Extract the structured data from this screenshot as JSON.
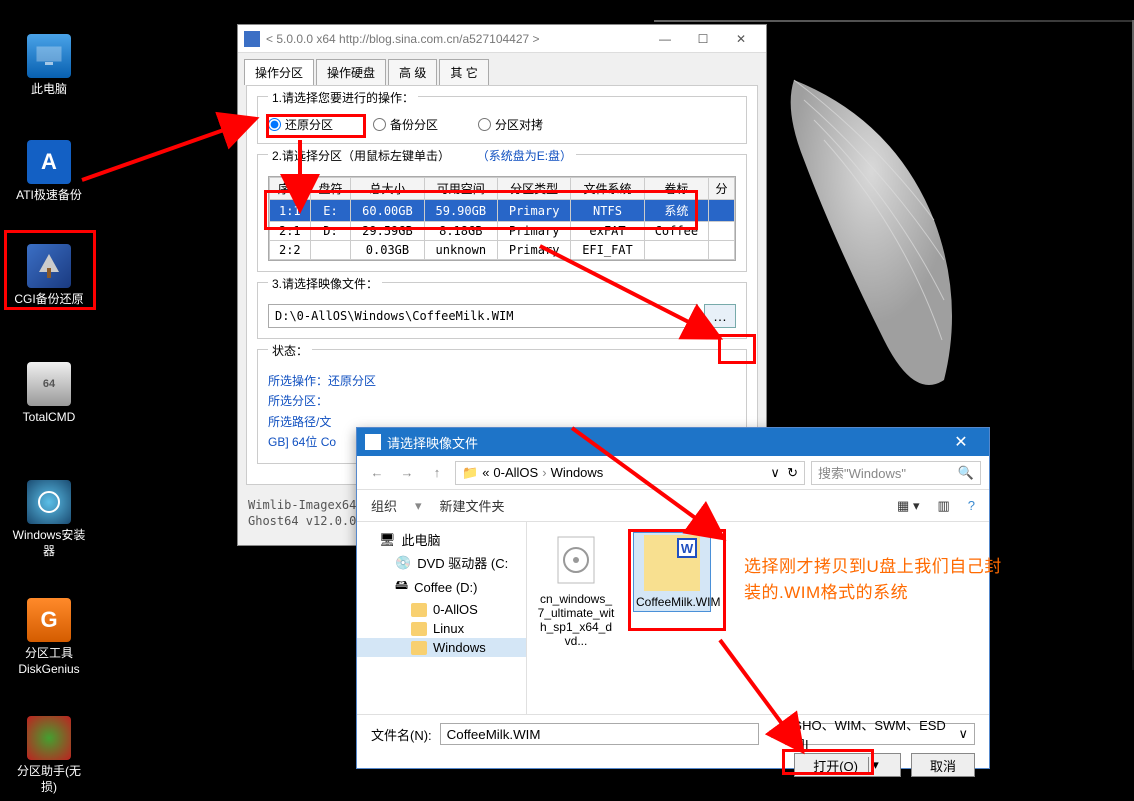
{
  "desktop_icons": {
    "pc": "此电脑",
    "ati": "ATI极速备份",
    "ati_letter": "A",
    "cgi": "CGI备份还原",
    "tc": "TotalCMD",
    "tc_badge": "64",
    "win": "Windows安装器",
    "dg": "分区工具DiskGenius",
    "dg_letter": "G",
    "pa": "分区助手(无损)"
  },
  "window": {
    "title": "< 5.0.0.0 x64 http://blog.sina.com.cn/a527104427 >",
    "tabs": [
      "操作分区",
      "操作硬盘",
      "高 级",
      "其 它"
    ],
    "section1": "1.请选择您要进行的操作：",
    "radios": [
      "还原分区",
      "备份分区",
      "分区对拷"
    ],
    "section2": "2.请选择分区（用鼠标左键单击）",
    "sysdisk": "（系统盘为E:盘）",
    "headers": [
      "序号",
      "盘符",
      "总大小",
      "可用空间",
      "分区类型",
      "文件系统",
      "卷标",
      "分"
    ],
    "rows": [
      {
        "idx": "1:1",
        "drv": "E:",
        "size": "60.00GB",
        "free": "59.90GB",
        "ptype": "Primary",
        "fs": "NTFS",
        "label": "系统"
      },
      {
        "idx": "2:1",
        "drv": "D:",
        "size": "29.59GB",
        "free": "8.18GB",
        "ptype": "Primary",
        "fs": "exFAT",
        "label": "Coffee"
      },
      {
        "idx": "2:2",
        "drv": "",
        "size": "0.03GB",
        "free": "unknown",
        "ptype": "Primary",
        "fs": "EFI_FAT",
        "label": ""
      }
    ],
    "section3": "3.请选择映像文件：",
    "image_path": "D:\\0-AllOS\\Windows\\CoffeeMilk.WIM",
    "status_label": "状态：",
    "status_op": "所选操作：还原分区",
    "status_part": "所选分区：",
    "status_path": "所选路径/文",
    "status_path2": "GB] 64位 Co",
    "footer1": "Wimlib-Imagex64",
    "footer2": "Ghost64 v12.0.0."
  },
  "opendlg": {
    "title": "请选择映像文件",
    "crumbs": [
      "0-AllOS",
      "Windows"
    ],
    "search_ph": "搜索\"Windows\"",
    "organize": "组织",
    "newfolder": "新建文件夹",
    "tree": {
      "pc": "此电脑",
      "dvd": "DVD 驱动器 (C:",
      "coffee": "Coffee (D:)",
      "allos": "0-AllOS",
      "linux": "Linux",
      "windows": "Windows"
    },
    "files": [
      {
        "name": "cn_windows_7_ultimate_with_sp1_x64_dvd..."
      },
      {
        "name": "CoffeeMilk.WIM"
      }
    ],
    "filename_label": "文件名(N):",
    "filename_value": "CoffeeMilk.WIM",
    "filter": "GHO、WIM、SWM、ESD和I",
    "open_btn": "打开(O)",
    "cancel_btn": "取消"
  },
  "annotation": {
    "line1": "选择刚才拷贝到U盘上我们自己封",
    "line2": "装的.WIM格式的系统"
  }
}
